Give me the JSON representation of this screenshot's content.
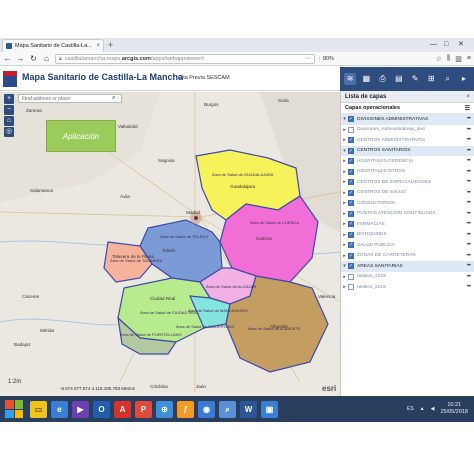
{
  "browser": {
    "tab_title": "Mapa Sanitario de Castilla-La...",
    "tab_close": "×",
    "new_tab": "+",
    "url_prefix": "castillalamancha.maps.",
    "url_domain": "arcgis.com",
    "url_suffix": "/apps/webappviewer/i",
    "zoom": "80%",
    "win_min": "—",
    "win_max": "□",
    "win_close": "✕"
  },
  "app": {
    "title": "Mapa Sanitario de Castilla-La Mancha",
    "cita": "Cita Previa SESCAM",
    "search_placeholder": "Find address or place",
    "aplicacion_label": "Aplicación"
  },
  "panel": {
    "title": "Lista de capas",
    "close": "×",
    "section": "Capas operacionales",
    "layers": [
      {
        "label": "DIVISIONES ADMINISTRATIVAS",
        "checked": true,
        "style": "strong"
      },
      {
        "label": "Divisiones_Administrativas_ded",
        "checked": false,
        "style": "dim"
      },
      {
        "label": "CENTROS ADMINISTRATIVOS",
        "checked": true,
        "style": "dim"
      },
      {
        "label": "CENTROS SANITARIOS",
        "checked": true,
        "style": "strong"
      },
      {
        "label": "HOSPITALES GERENCIA",
        "checked": true,
        "style": "dim"
      },
      {
        "label": "HOSPITALES OTROS",
        "checked": true,
        "style": "dim"
      },
      {
        "label": "CENTROS DE ESPECIALIDADES",
        "checked": true,
        "style": "dim"
      },
      {
        "label": "CENTROS DE SALUD",
        "checked": true,
        "style": "dim"
      },
      {
        "label": "CONSULTORIOS",
        "checked": true,
        "style": "dim"
      },
      {
        "label": "PUNTOS ATENCIÓN CONTINUADA",
        "checked": true,
        "style": "dim"
      },
      {
        "label": "FARMACIAS",
        "checked": true,
        "style": "dim"
      },
      {
        "label": "BOTIQUINES",
        "checked": true,
        "style": "dim"
      },
      {
        "label": "SALUD PÚBLICA",
        "checked": true,
        "style": "dim"
      },
      {
        "label": "ZONAS DE CARRETERAS",
        "checked": true,
        "style": "dim"
      },
      {
        "label": "ÁREAS SANITARIAS",
        "checked": true,
        "style": "strong"
      },
      {
        "label": "relatios_2019",
        "checked": false,
        "style": "dim"
      },
      {
        "label": "relatios_2019",
        "checked": false,
        "style": "dim"
      }
    ]
  },
  "map": {
    "cities": [
      "Valladolid",
      "Segovia",
      "Salamanca",
      "Ávila",
      "Madrid",
      "Guadalajara",
      "Toledo",
      "Cuenca",
      "Ciudad Real",
      "Albacete",
      "Talavera de la Reina",
      "Soria",
      "Zamora",
      "Burgos",
      "Cáceres",
      "Badajoz",
      "Mérida",
      "Valencia",
      "Jaén",
      "Córdoba"
    ],
    "area_labels": [
      "Área de Salud de GUADALAJARA",
      "Área de Salud de CUENCA",
      "Área de Salud de TOLEDO",
      "Área de Salud de TALAVERA",
      "Área de Salud de CIUDAD REAL",
      "Área de Salud de ALBACETE",
      "Área de Salud de PUERTOLLANO",
      "Área de Salud de ALCÁZAR",
      "Área de Salud de MANZANARES",
      "Área de Salud de VALDEPEÑAS"
    ],
    "scale_text": "-5.574 077.074  4.118.190.783 Metros",
    "zoom_readout": "1:2m",
    "attribution": "esri",
    "colors": {
      "guadalajara": "#f6f25a",
      "cuenca": "#f06ed6",
      "toledo": "#7c9bd6",
      "talavera": "#f7b39a",
      "ciudad_real": "#b6eb8e",
      "albacete": "#c49e61",
      "puertollano": "#b5c9a0",
      "alcazar": "#f3b0e2",
      "manzanares": "#86e4df"
    }
  },
  "taskbar": {
    "lang": "ES",
    "time": "10:21",
    "date": "25/05/2018"
  }
}
